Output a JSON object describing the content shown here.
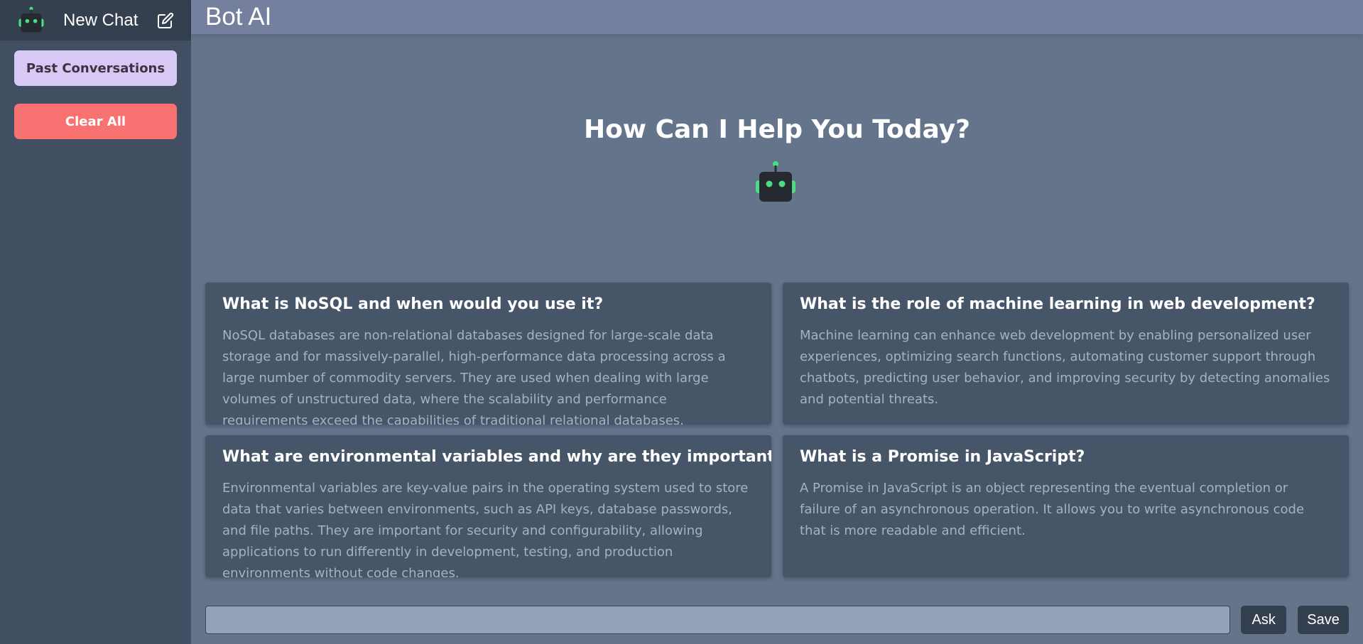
{
  "sidebar": {
    "new_chat_label": "New Chat",
    "past_conversations_label": "Past Conversations",
    "clear_all_label": "Clear All",
    "icons": {
      "logo": "robot-icon",
      "edit": "edit-icon"
    }
  },
  "header": {
    "title": "Bot AI"
  },
  "main": {
    "greeting": "How Can I Help You Today?",
    "cards": [
      {
        "question": "What is NoSQL and when would you use it?",
        "answer": "NoSQL databases are non-relational databases designed for large-scale data storage and for massively-parallel, high-performance data processing across a large number of commodity servers. They are used when dealing with large volumes of unstructured data, where the scalability and performance requirements exceed the capabilities of traditional relational databases."
      },
      {
        "question": "What is the role of machine learning in web development?",
        "answer": "Machine learning can enhance web development by enabling personalized user experiences, optimizing search functions, automating customer support through chatbots, predicting user behavior, and improving security by detecting anomalies and potential threats."
      },
      {
        "question": "What are environmental variables and why are they important?",
        "answer": "Environmental variables are key-value pairs in the operating system used to store data that varies between environments, such as API keys, database passwords, and file paths. They are important for security and configurability, allowing applications to run differently in development, testing, and production environments without code changes."
      },
      {
        "question": "What is a Promise in JavaScript?",
        "answer": "A Promise in JavaScript is an object representing the eventual completion or failure of an asynchronous operation. It allows you to write asynchronous code that is more readable and efficient."
      }
    ]
  },
  "composer": {
    "input_value": "",
    "ask_label": "Ask",
    "save_label": "Save"
  },
  "colors": {
    "background": "#64748b",
    "sidebar": "#424f63",
    "card": "#475569",
    "past_button": "#d8c8f5",
    "clear_button": "#f87272",
    "robot_accent": "#4ade80"
  }
}
